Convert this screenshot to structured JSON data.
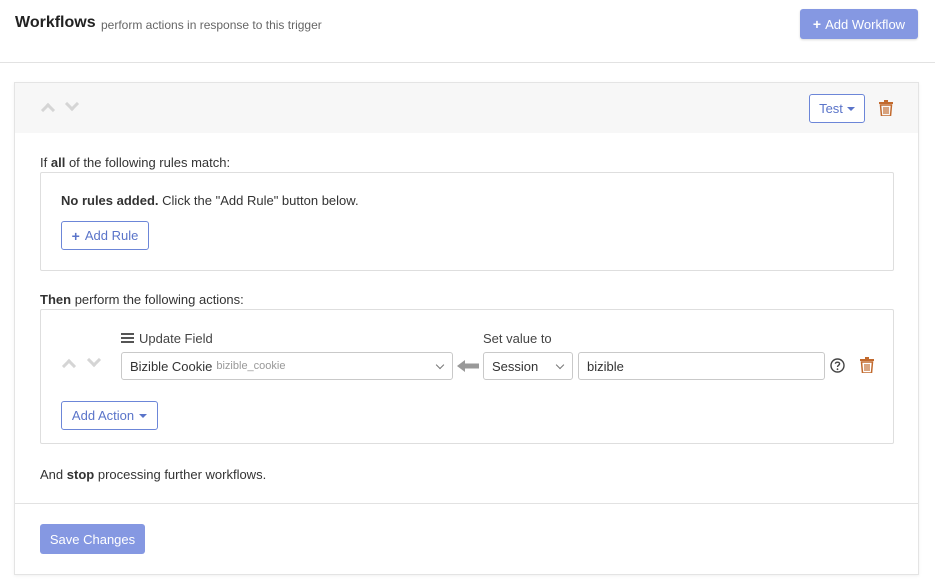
{
  "header": {
    "title": "Workflows",
    "subtitle": "perform actions in response to this trigger",
    "add_workflow_label": "Add Workflow"
  },
  "workflow": {
    "test_label": "Test",
    "rules": {
      "prefix": "If",
      "quantifier": "all",
      "suffix": "of the following rules match:",
      "empty_bold": "No rules added.",
      "empty_text": "Click the \"Add Rule\" button below.",
      "add_rule_label": "Add Rule"
    },
    "actions": {
      "prefix_bold": "Then",
      "suffix": "perform the following actions:",
      "update_field_label": "Update Field",
      "field_value": "Bizible Cookie",
      "field_key": "bizible_cookie",
      "set_value_label": "Set value to",
      "source_value": "Session",
      "input_value": "bizible",
      "add_action_label": "Add Action"
    },
    "stop": {
      "prefix": "And",
      "bold": "stop",
      "suffix": "processing further workflows."
    },
    "save_label": "Save Changes"
  },
  "colors": {
    "primary": "#8598e2",
    "outline": "#6c86d8",
    "trash": "#c26a2e"
  }
}
